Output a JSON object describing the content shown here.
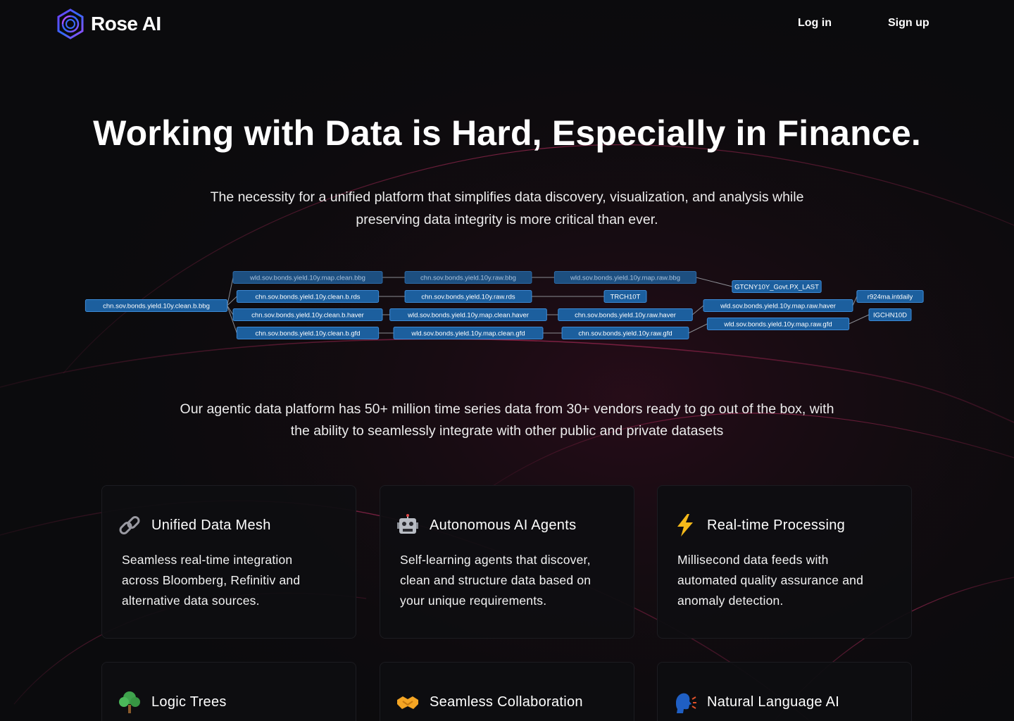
{
  "brand": {
    "name": "Rose AI"
  },
  "nav": {
    "login_label": "Log in",
    "signup_label": "Sign up"
  },
  "hero": {
    "title": "Working with Data is Hard, Especially in Finance.",
    "subtitle_line1": "The necessity for a unified platform that simplifies data discovery, visualization, and analysis while",
    "subtitle_line2": "preserving data integrity is more critical than ever."
  },
  "lineage_graph": {
    "root": "chn.sov.bonds.yield.10y.clean.b.bbg",
    "col1": [
      "wld.sov.bonds.yield.10y.map.clean.bbg",
      "chn.sov.bonds.yield.10y.clean.b.rds",
      "chn.sov.bonds.yield.10y.clean.b.haver",
      "chn.sov.bonds.yield.10y.clean.b.gfd"
    ],
    "col2": [
      "chn.sov.bonds.yield.10y.raw.bbg",
      "chn.sov.bonds.yield.10y.raw.rds",
      "wld.sov.bonds.yield.10y.map.clean.haver",
      "wld.sov.bonds.yield.10y.map.clean.gfd"
    ],
    "col3": [
      "wld.sov.bonds.yield.10y.map.raw.bbg",
      "TRCH10T",
      "chn.sov.bonds.yield.10y.raw.haver",
      "chn.sov.bonds.yield.10y.raw.gfd"
    ],
    "col4": [
      "GTCNY10Y_Govt.PX_LAST",
      "wld.sov.bonds.yield.10y.map.raw.haver",
      "wld.sov.bonds.yield.10y.map.raw.gfd"
    ],
    "col5": [
      "r924ma.intdaily",
      "IGCHN10D"
    ]
  },
  "stat": {
    "line1": "Our agentic data platform has 50+ million time series data from 30+ vendors ready to go out of the box, with",
    "line2": "the ability to seamlessly integrate with other public and private datasets"
  },
  "features": [
    {
      "icon": "link-icon",
      "title": "Unified Data Mesh",
      "desc": [
        "Seamless real-time integration",
        "across Bloomberg, Refinitiv and",
        "alternative data sources."
      ]
    },
    {
      "icon": "robot-icon",
      "title": "Autonomous AI Agents",
      "desc": [
        "Self-learning agents that discover,",
        "clean and structure data based on",
        "your unique requirements."
      ]
    },
    {
      "icon": "lightning-icon",
      "title": "Real-time Processing",
      "desc": [
        "Millisecond data feeds with",
        "automated quality assurance and",
        "anomaly detection."
      ]
    },
    {
      "icon": "tree-icon",
      "title": "Logic Trees",
      "desc": []
    },
    {
      "icon": "handshake-icon",
      "title": "Seamless Collaboration",
      "desc": []
    },
    {
      "icon": "speaking-head-icon",
      "title": "Natural Language AI",
      "desc": []
    }
  ],
  "colors": {
    "background": "#0b0b0d",
    "node_fill": "#1c5f9e",
    "node_border": "#3c8ad6",
    "glow": "#c0285f"
  }
}
